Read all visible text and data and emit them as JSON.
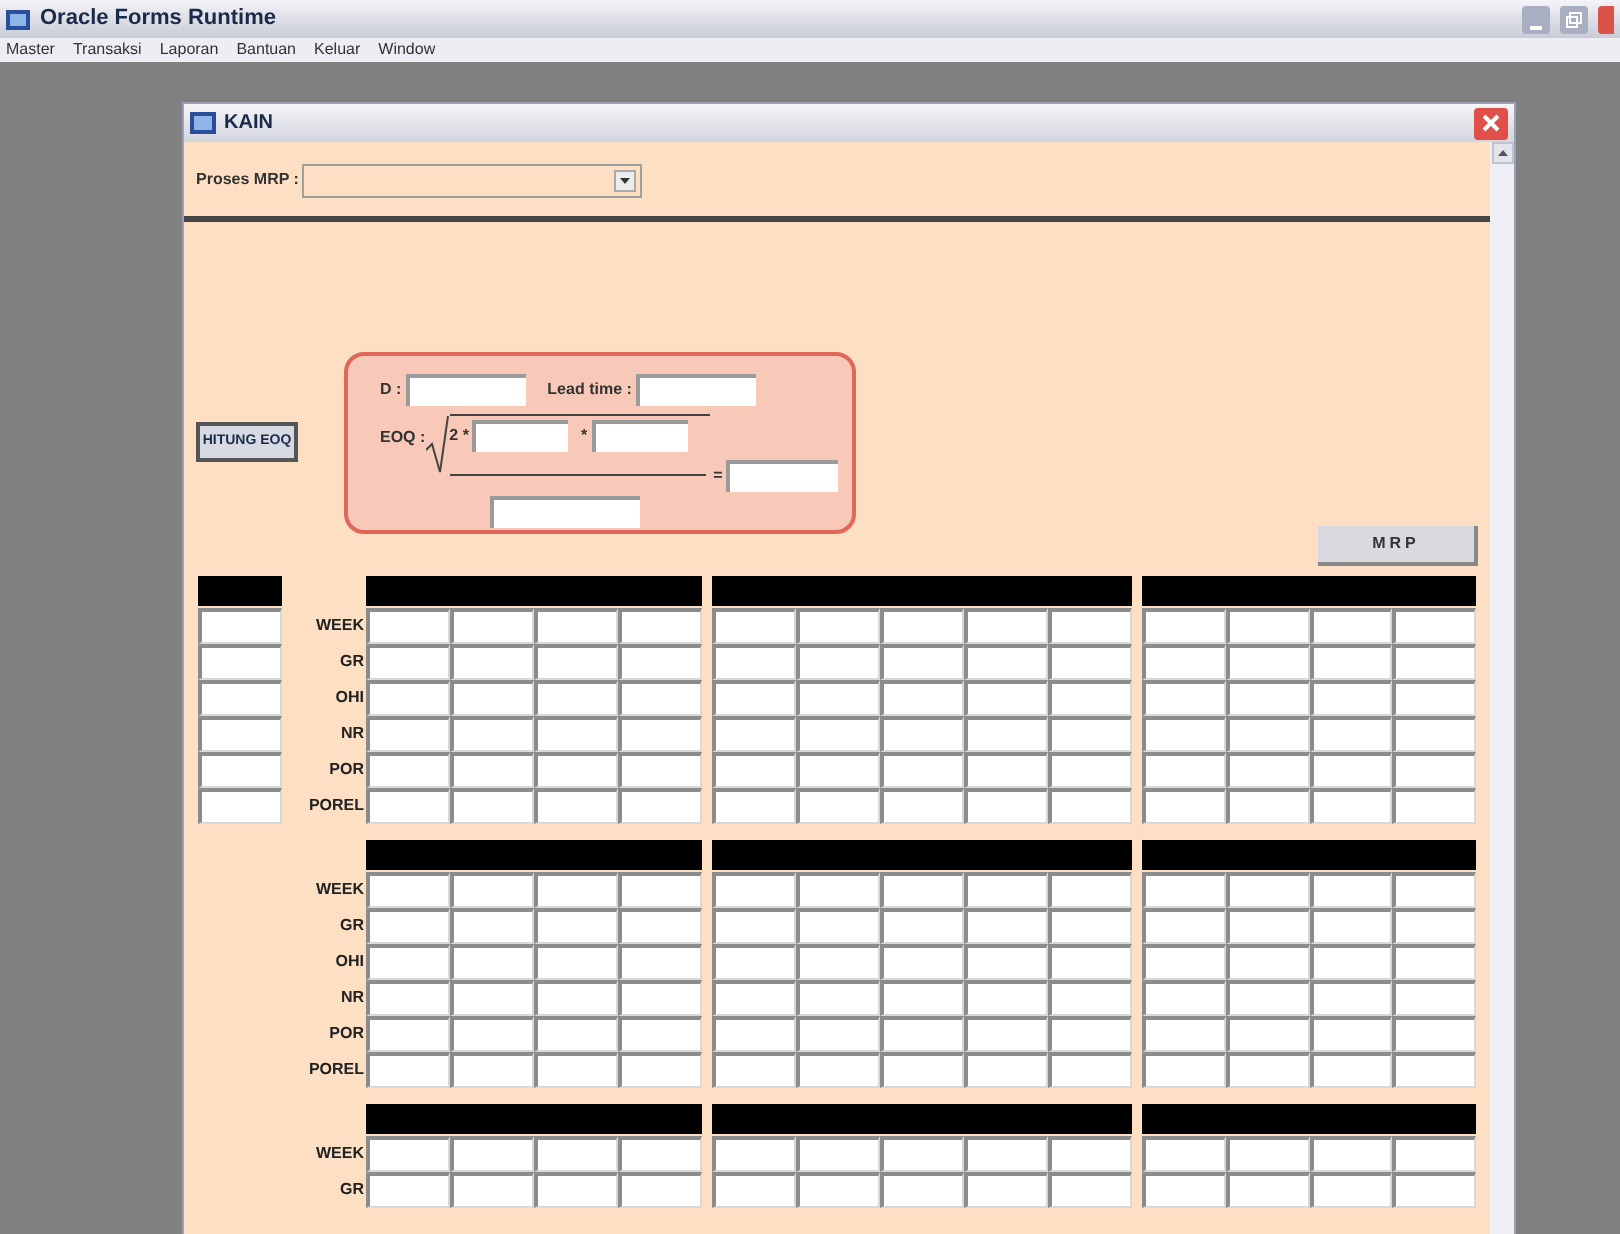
{
  "window": {
    "title": "Oracle Forms Runtime"
  },
  "menu": [
    "Master",
    "Transaksi",
    "Laporan",
    "Bantuan",
    "Keluar",
    "Window"
  ],
  "form": {
    "title": "KAIN",
    "proses_mrp": {
      "label": "Proses MRP :"
    },
    "hitung_button": "HITUNG EOQ",
    "eoq_panel": {
      "d_label": "D :",
      "lead_time_label": "Lead time :",
      "eoq_label": "EOQ :",
      "two_times": "2 *",
      "times": "*",
      "equals": "="
    },
    "mrp_button": "MRP",
    "blocks": [
      {
        "side_column": true,
        "row_labels": [
          "WEEK",
          "GR",
          "OHI",
          "NR",
          "POR",
          "POREL"
        ]
      },
      {
        "side_column": false,
        "row_labels": [
          "WEEK",
          "GR",
          "OHI",
          "NR",
          "POR",
          "POREL"
        ]
      },
      {
        "side_column": false,
        "row_labels": [
          "WEEK",
          "GR"
        ]
      }
    ]
  }
}
